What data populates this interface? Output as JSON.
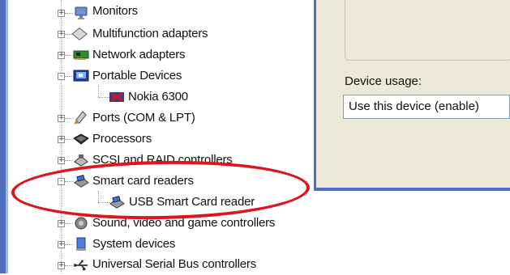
{
  "tree": {
    "items": [
      {
        "label": "Monitors",
        "icon": "monitor-icon",
        "expander": "+"
      },
      {
        "label": "Multifunction adapters",
        "icon": "multifunction-icon",
        "expander": "+"
      },
      {
        "label": "Network adapters",
        "icon": "network-card-icon",
        "expander": "+"
      },
      {
        "label": "Portable Devices",
        "icon": "portable-device-icon",
        "expander": "-"
      },
      {
        "label": "Nokia 6300",
        "icon": "phone-device-icon",
        "expander": ""
      },
      {
        "label": "Ports (COM & LPT)",
        "icon": "port-icon",
        "expander": "+"
      },
      {
        "label": "Processors",
        "icon": "processor-icon",
        "expander": "+"
      },
      {
        "label": "SCSI and RAID controllers",
        "icon": "scsi-icon",
        "expander": "+"
      },
      {
        "label": "Smart card readers",
        "icon": "smart-card-reader-icon",
        "expander": "-"
      },
      {
        "label": "USB Smart Card reader",
        "icon": "smart-card-reader-icon",
        "expander": ""
      },
      {
        "label": "Sound, video and game controllers",
        "icon": "sound-icon",
        "expander": "+"
      },
      {
        "label": "System devices",
        "icon": "system-device-icon",
        "expander": "+"
      },
      {
        "label": "Universal Serial Bus controllers",
        "icon": "usb-icon",
        "expander": "+"
      }
    ]
  },
  "properties": {
    "device_usage_label": "Device usage:",
    "device_usage_value": "Use this device (enable)"
  },
  "colors": {
    "highlight": "#e0141c",
    "window_border": "#4c6fc5",
    "dialog_bg": "#ece9d8"
  }
}
